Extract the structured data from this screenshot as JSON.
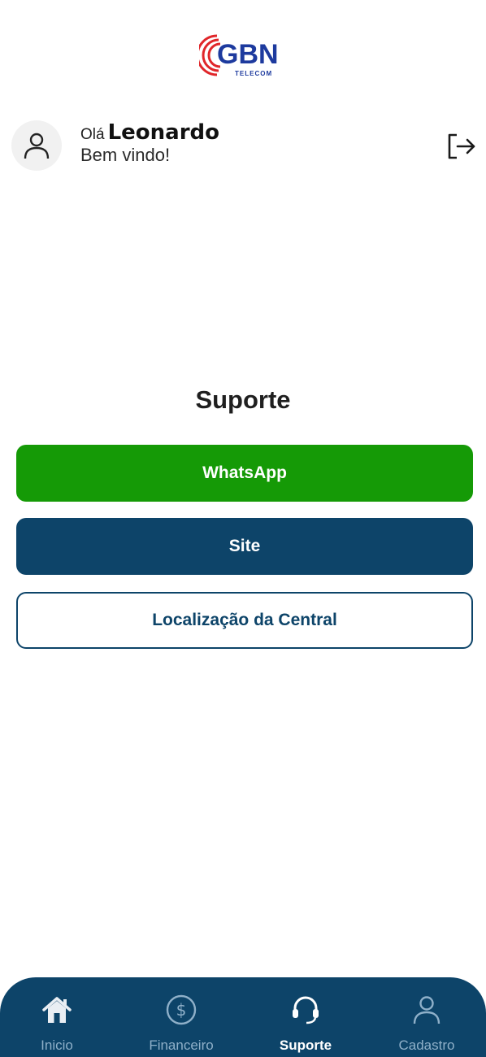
{
  "brand": {
    "logo_text": "GBN",
    "logo_subtext": "TELECOM"
  },
  "header": {
    "greeting_prefix": "Olá",
    "user_name": "Leonardo",
    "welcome": "Bem vindo!",
    "avatar_icon": "user-icon",
    "logout_icon": "logout-icon"
  },
  "page": {
    "title": "Suporte"
  },
  "buttons": {
    "whatsapp": "WhatsApp",
    "site": "Site",
    "location": "Localização da Central"
  },
  "nav": {
    "items": [
      {
        "label": "Inicio",
        "icon": "home-icon",
        "active": false
      },
      {
        "label": "Financeiro",
        "icon": "dollar-icon",
        "active": false
      },
      {
        "label": "Suporte",
        "icon": "headset-icon",
        "active": true
      },
      {
        "label": "Cadastro",
        "icon": "user-icon",
        "active": false
      }
    ]
  },
  "colors": {
    "whatsapp": "#159a06",
    "primary": "#0d4469",
    "logo_blue": "#1d3a9e",
    "logo_red": "#e0262a"
  }
}
